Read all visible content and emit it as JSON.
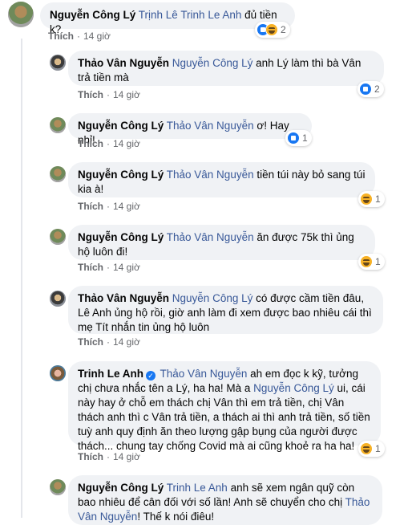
{
  "labels": {
    "like": "Thích",
    "dot": "·"
  },
  "verified_mark": "✓",
  "comments": [
    {
      "author": "Nguyễn Công Lý",
      "tags": [
        "Trịnh Lê",
        "Trinh Le Anh"
      ],
      "text": " đủ tiền k?",
      "time": "14 giờ",
      "reactions": {
        "icons": [
          "like-icon",
          "haha-icon"
        ],
        "count": "2"
      }
    },
    {
      "author": "Thảo Vân Nguyễn",
      "tags": [
        "Nguyễn Công Lý"
      ],
      "text": " anh Lý làm thì bà Vân trả tiền mà",
      "time": "14 giờ",
      "reactions": {
        "icons": [
          "like-icon"
        ],
        "count": "2"
      }
    },
    {
      "author": "Nguyễn Công Lý",
      "tags": [
        "Thảo Vân Nguyễn"
      ],
      "text": " ơ! Hay nhỉ!",
      "time": "14 giờ",
      "reactions": {
        "icons": [
          "like-icon"
        ],
        "count": "1"
      }
    },
    {
      "author": "Nguyễn Công Lý",
      "tags": [
        "Thảo Vân Nguyễn"
      ],
      "text": " tiền túi này bỏ sang túi kia à!",
      "time": "14 giờ",
      "reactions": {
        "icons": [
          "haha-icon"
        ],
        "count": "1"
      }
    },
    {
      "author": "Nguyễn Công Lý",
      "tags": [
        "Thảo Vân Nguyễn"
      ],
      "text": " ăn được 75k thì ủng hộ luôn đi!",
      "time": "14 giờ",
      "reactions": {
        "icons": [
          "haha-icon"
        ],
        "count": "1"
      }
    },
    {
      "author": "Thảo Vân Nguyễn",
      "tags": [
        "Nguyễn Công Lý"
      ],
      "text": " có được cầm tiền đâu, Lê Anh ủng hộ rồi, giờ anh làm đi xem được bao nhiêu cái thì mẹ Tít nhắn tin ủng hộ luôn",
      "time": "14 giờ",
      "reactions": null
    },
    {
      "author": "Trinh Le Anh",
      "tags": [
        "Thảo Vân Nguyễn"
      ],
      "text_parts": [
        " ah em đọc k kỹ, tưởng chị chưa nhắc tên a Lý, ha ha! Mà a ",
        " ui, cái này hay ở chỗ em thách chị Vân thì em trả tiền, chị Vân thách anh thì c Vân trả tiền, a thách ai thì anh trả tiền, số tiền tuỳ anh quy định ăn theo lượng gập bụng của người được thách... chung tay chống Covid mà ai cũng khoẻ ra ha ha!"
      ],
      "inline_tag": "Nguyễn Công Lý",
      "time": "14 giờ",
      "reactions": {
        "icons": [
          "haha-icon"
        ],
        "count": "1"
      }
    },
    {
      "author": "Nguyễn Công Lý",
      "tags": [
        "Trinh Le Anh"
      ],
      "text_parts": [
        " anh sẽ xem ngân quỹ còn bao nhiêu để cân đối với số lần! Anh sẽ chuyển cho chị ",
        "! Thế k nói điêu!"
      ],
      "inline_tag": "Thảo Vân Nguyễn",
      "time": "",
      "reactions": null
    }
  ]
}
